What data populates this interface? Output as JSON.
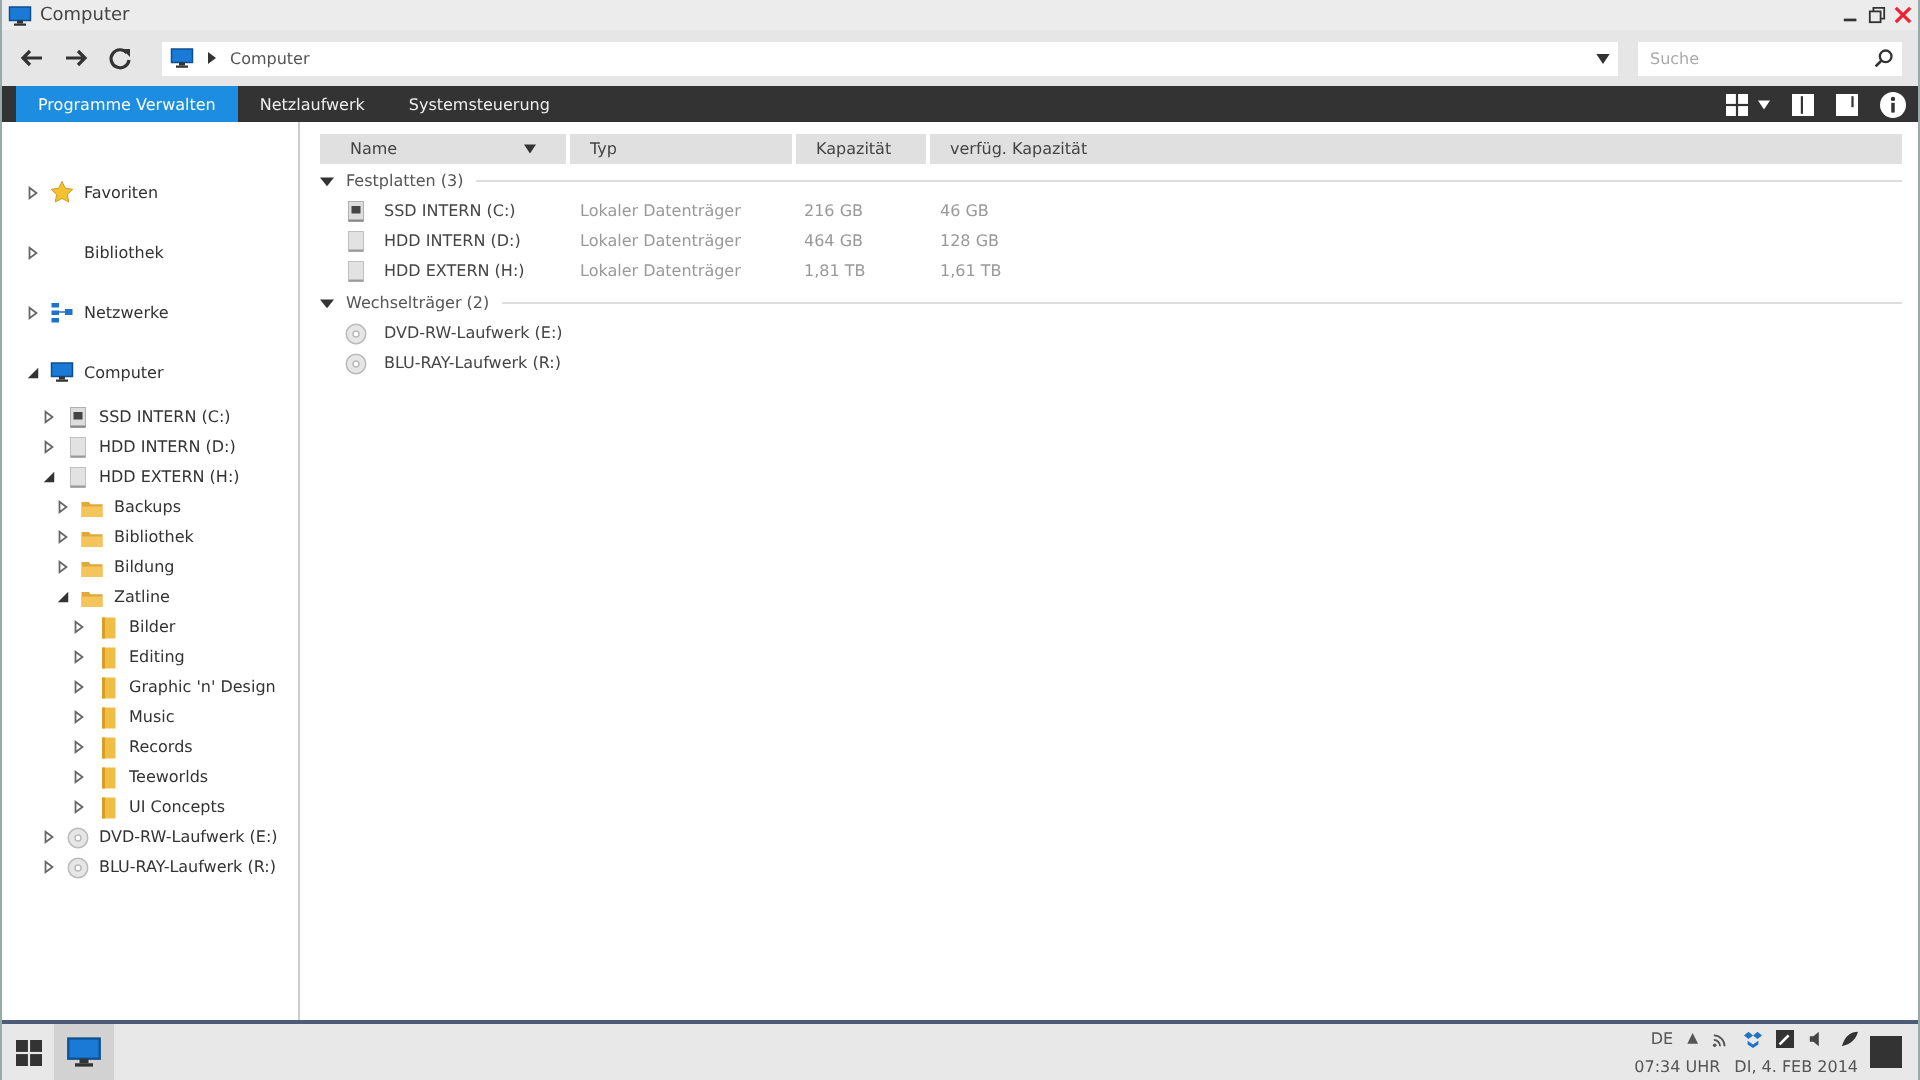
{
  "window": {
    "title": "Computer"
  },
  "address": {
    "path": "Computer"
  },
  "search": {
    "placeholder": "Suche"
  },
  "tabs": [
    {
      "label": "Programme Verwalten",
      "selected": true
    },
    {
      "label": "Netzlaufwerk",
      "selected": false
    },
    {
      "label": "Systemsteuerung",
      "selected": false
    }
  ],
  "sidebar": {
    "sections": [
      {
        "label": "Favoriten",
        "kind": "star",
        "expanded": false
      },
      {
        "label": "Bibliothek",
        "kind": "none",
        "expanded": false
      },
      {
        "label": "Netzwerke",
        "kind": "network",
        "expanded": false
      },
      {
        "label": "Computer",
        "kind": "computer",
        "expanded": true,
        "children": [
          {
            "label": "SSD INTERN (C:)",
            "kind": "ssd",
            "expanded": false
          },
          {
            "label": "HDD INTERN (D:)",
            "kind": "hdd",
            "expanded": false
          },
          {
            "label": "HDD EXTERN (H:)",
            "kind": "hdd",
            "expanded": true,
            "children": [
              {
                "label": "Backups",
                "kind": "folder",
                "expanded": false
              },
              {
                "label": "Bibliothek",
                "kind": "folder",
                "expanded": false
              },
              {
                "label": "Bildung",
                "kind": "folder",
                "expanded": false
              },
              {
                "label": "Zatline",
                "kind": "folder",
                "expanded": true,
                "children": [
                  {
                    "label": "Bilder",
                    "kind": "binder",
                    "expanded": false
                  },
                  {
                    "label": "Editing",
                    "kind": "binder",
                    "expanded": false
                  },
                  {
                    "label": "Graphic 'n' Design",
                    "kind": "binder",
                    "expanded": false
                  },
                  {
                    "label": "Music",
                    "kind": "binder",
                    "expanded": false
                  },
                  {
                    "label": "Records",
                    "kind": "binder",
                    "expanded": false
                  },
                  {
                    "label": "Teeworlds",
                    "kind": "binder",
                    "expanded": false
                  },
                  {
                    "label": "UI Concepts",
                    "kind": "binder",
                    "expanded": false
                  }
                ]
              }
            ]
          },
          {
            "label": "DVD-RW-Laufwerk (E:)",
            "kind": "disc",
            "expanded": false
          },
          {
            "label": "BLU-RAY-Laufwerk (R:)",
            "kind": "disc",
            "expanded": false
          }
        ]
      }
    ]
  },
  "table": {
    "columns": [
      "Name",
      "Typ",
      "Kapazität",
      "verfüg. Kapazität"
    ],
    "groups": [
      {
        "label": "Festplatten (3)",
        "expanded": true,
        "rows": [
          {
            "kind": "ssd",
            "name": "SSD INTERN (C:)",
            "type": "Lokaler Datenträger",
            "capacity": "216 GB",
            "free": "46 GB"
          },
          {
            "kind": "hdd",
            "name": "HDD INTERN (D:)",
            "type": "Lokaler Datenträger",
            "capacity": "464 GB",
            "free": "128 GB"
          },
          {
            "kind": "hdd",
            "name": "HDD EXTERN (H:)",
            "type": "Lokaler Datenträger",
            "capacity": "1,81 TB",
            "free": "1,61 TB"
          }
        ]
      },
      {
        "label": "Wechselträger (2)",
        "expanded": true,
        "rows": [
          {
            "kind": "disc",
            "name": "DVD-RW-Laufwerk (E:)"
          },
          {
            "kind": "disc",
            "name": "BLU-RAY-Laufwerk (R:)"
          }
        ]
      }
    ]
  },
  "taskbar": {
    "apps": [
      {
        "kind": "computer",
        "selected": true
      }
    ]
  },
  "tray": {
    "language": "DE",
    "expander": "▲",
    "time": "07:34 UHR",
    "date": "DI, 4. FEB 2014"
  }
}
